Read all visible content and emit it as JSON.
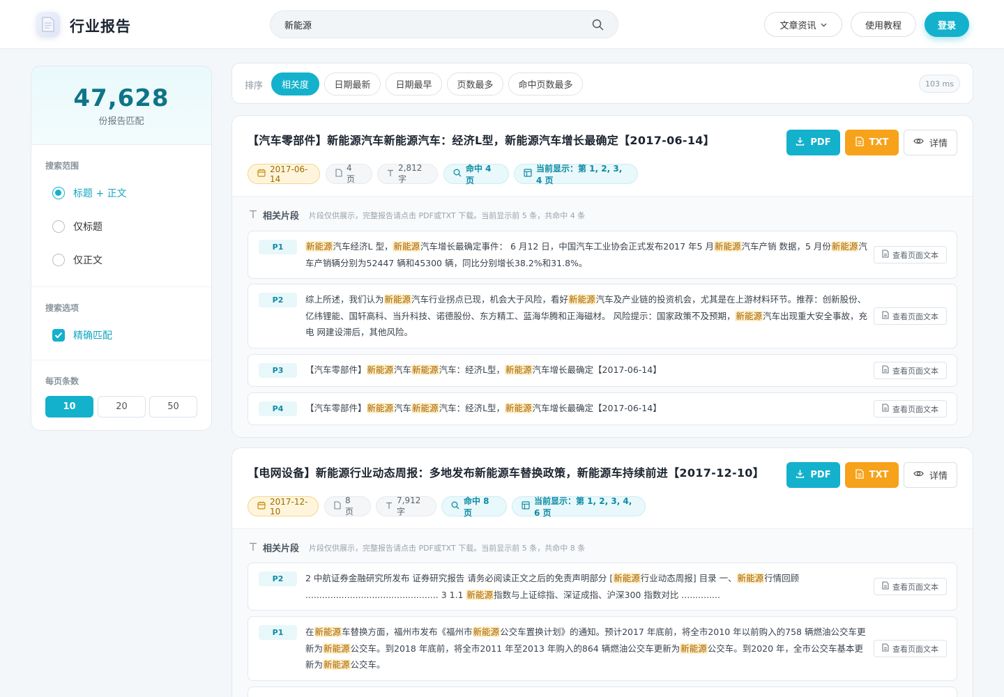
{
  "header": {
    "brand": "行业报告",
    "search_value": "新能源",
    "articles_label": "文章资讯",
    "tutorial_label": "使用教程",
    "login_label": "登录",
    "accent_color": "#14b1cc"
  },
  "sidebar": {
    "match_count": "47,628",
    "match_label": "份报告匹配",
    "scope_title": "搜索范围",
    "scope_options": [
      {
        "label": "标题 + 正文",
        "selected": true
      },
      {
        "label": "仅标题",
        "selected": false
      },
      {
        "label": "仅正文",
        "selected": false
      }
    ],
    "options_title": "搜索选项",
    "exact_match_label": "精确匹配",
    "exact_match_checked": true,
    "per_page_title": "每页条数",
    "per_page_options": [
      "10",
      "20",
      "50"
    ],
    "per_page_selected": "10"
  },
  "sortbar": {
    "label": "排序",
    "options": [
      "相关度",
      "日期最新",
      "日期最早",
      "页数最多",
      "命中页数最多"
    ],
    "selected": "相关度",
    "timing": "103 ms"
  },
  "actions": {
    "pdf": "PDF",
    "txt": "TXT",
    "details": "详情",
    "view_page_text": "查看页面文本"
  },
  "results": [
    {
      "title": "【汽车零部件】新能源汽车新能源汽车：经济L型，新能源汽车增长最确定【2017-06-14】",
      "date": "2017-06-14",
      "pages": "4 页",
      "chars": "2,812 字",
      "hits": "命中 4 页",
      "showing": "当前显示：第 1, 2, 3, 4 页",
      "fragments_title": "相关片段",
      "fragments_note": "片段仅供展示，完整报告请点击 PDF或TXT 下载。当前显示前 5 条，共命中 4 条",
      "fragments": [
        {
          "page": "P1",
          "segments": [
            [
              "新能源",
              true
            ],
            [
              "汽车经济L 型，",
              false
            ],
            [
              "新能源",
              true
            ],
            [
              "汽车增长最确定事件：  6 月12 日，中国汽车工业协会正式发布2017 年5 月",
              false
            ],
            [
              "新能源",
              true
            ],
            [
              "汽车产销 数据，5 月份",
              false
            ],
            [
              "新能源",
              true
            ],
            [
              "汽车产销辆分别为52447 辆和45300 辆，同比分别增长38.2%和31.8%。",
              false
            ]
          ]
        },
        {
          "page": "P2",
          "segments": [
            [
              "综上所述，我们认为",
              false
            ],
            [
              "新能源",
              true
            ],
            [
              "汽车行业拐点已现，机会大于风险，看好",
              false
            ],
            [
              "新能源",
              true
            ],
            [
              "汽车及产业链的投资机会，尤其是在上游材料环节。推荐：创新股份、亿纬锂能、国轩高科、当升科技、诺德股份、东方精工、蓝海华腾和正海磁材。 风险提示：国家政策不及预期，",
              false
            ],
            [
              "新能源",
              true
            ],
            [
              "汽车出现重大安全事故，充电 网建设滞后，其他风险。",
              false
            ]
          ]
        },
        {
          "page": "P3",
          "segments": [
            [
              "【汽车零部件】",
              false
            ],
            [
              "新能源",
              true
            ],
            [
              "汽车",
              false
            ],
            [
              "新能源",
              true
            ],
            [
              "汽车：经济L型，",
              false
            ],
            [
              "新能源",
              true
            ],
            [
              "汽车增长最确定【2017-06-14】",
              false
            ]
          ]
        },
        {
          "page": "P4",
          "segments": [
            [
              "【汽车零部件】",
              false
            ],
            [
              "新能源",
              true
            ],
            [
              "汽车",
              false
            ],
            [
              "新能源",
              true
            ],
            [
              "汽车：经济L型，",
              false
            ],
            [
              "新能源",
              true
            ],
            [
              "汽车增长最确定【2017-06-14】",
              false
            ]
          ]
        }
      ]
    },
    {
      "title": "【电网设备】新能源行业动态周报：多地发布新能源车替换政策，新能源车持续前进【2017-12-10】",
      "date": "2017-12-10",
      "pages": "8 页",
      "chars": "7,912 字",
      "hits": "命中 8 页",
      "showing": "当前显示：第 1, 2, 3, 4, 6 页",
      "fragments_title": "相关片段",
      "fragments_note": "片段仅供展示，完整报告请点击 PDF或TXT 下载。当前显示前 5 条，共命中 8 条",
      "fragments": [
        {
          "page": "P2",
          "segments": [
            [
              "2 中航证券金融研究所发布 证券研究报告 请务必阅读正文之后的免责声明部分 [",
              false
            ],
            [
              "新能源",
              true
            ],
            [
              "行业动态周报] 目录 一、",
              false
            ],
            [
              "新能源",
              true
            ],
            [
              "行情回顾 ................................................ 3 1.1 ",
              false
            ],
            [
              "新能源",
              true
            ],
            [
              "指数与上证综指、深证成指、沪深300 指数对比 ..............",
              false
            ]
          ]
        },
        {
          "page": "P1",
          "segments": [
            [
              "在",
              false
            ],
            [
              "新能源",
              true
            ],
            [
              "车替换方面，福州市发布《福州市",
              false
            ],
            [
              "新能源",
              true
            ],
            [
              "公交车置换计划》的通知。预计2017 年底前，将全市2010 年以前购入的758 辆燃油公交车更新为",
              false
            ],
            [
              "新能源",
              true
            ],
            [
              "公交车。到2018 年底前，将全市2011 年至2013 年购入的864 辆燃油公交车更新为",
              false
            ],
            [
              "新能源",
              true
            ],
            [
              "公交车。到2020 年，全市公交车基本更新为",
              false
            ],
            [
              "新能源",
              true
            ],
            [
              "公交车。",
              false
            ]
          ]
        }
      ]
    }
  ]
}
